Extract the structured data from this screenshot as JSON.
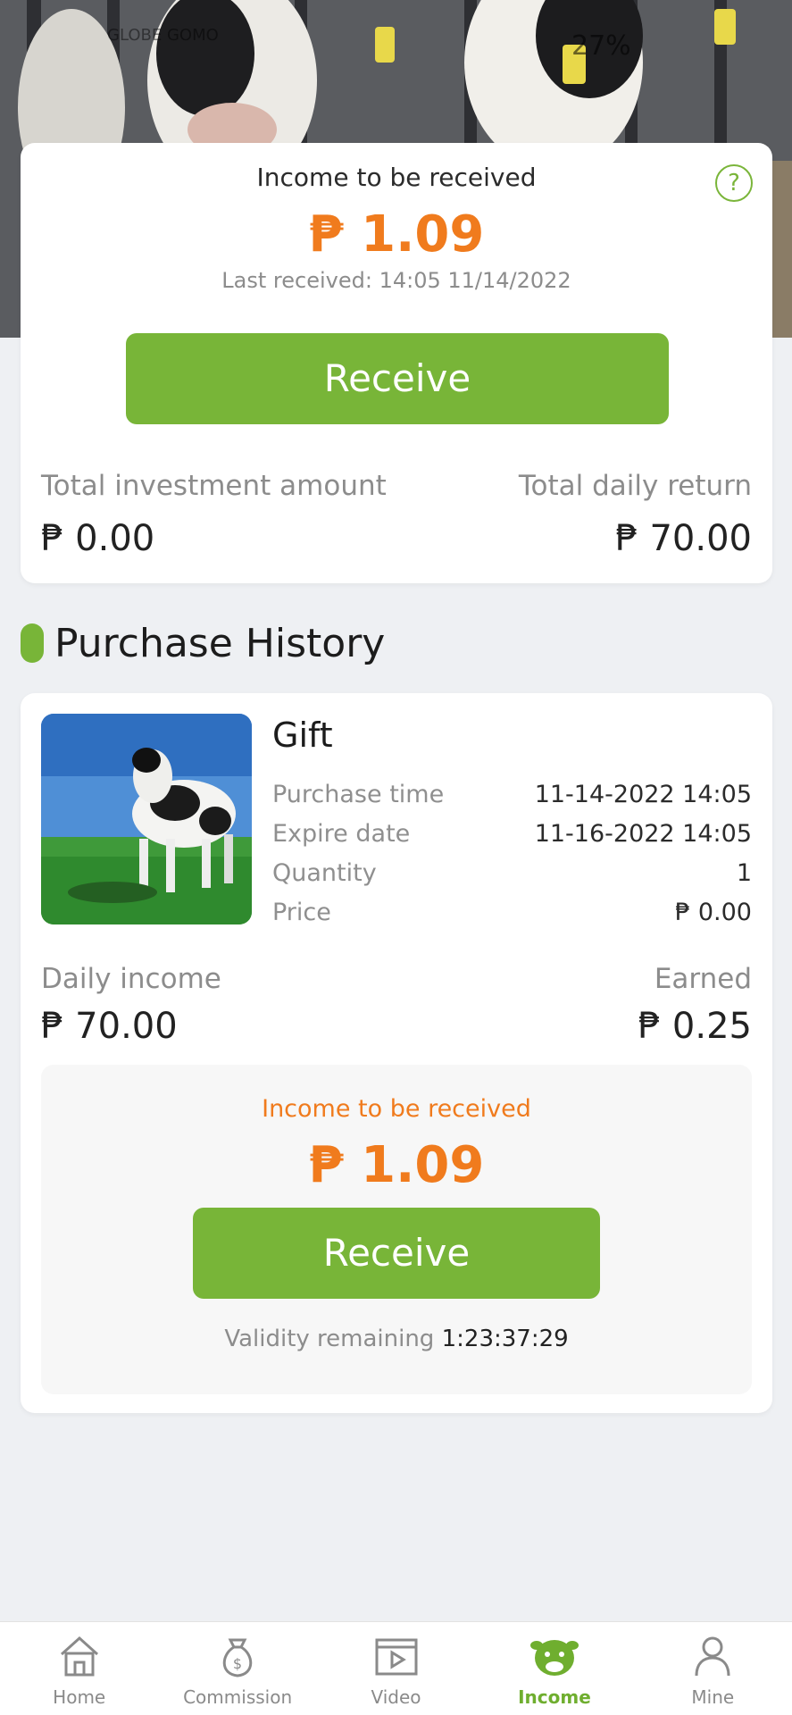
{
  "status_bar": {
    "carrier": "GLOBE GOMO",
    "battery": "27%"
  },
  "summary": {
    "title": "Income to be received",
    "amount": "₱ 1.09",
    "last_received": "Last received: 14:05 11/14/2022",
    "receive_label": "Receive",
    "total_investment_label": "Total investment amount",
    "total_investment_value": "₱ 0.00",
    "total_daily_label": "Total daily return",
    "total_daily_value": "₱ 70.00"
  },
  "section": {
    "title": "Purchase History"
  },
  "purchase": {
    "name": "Gift",
    "rows": [
      {
        "label": "Purchase time",
        "value": "11-14-2022 14:05"
      },
      {
        "label": "Expire date",
        "value": "11-16-2022 14:05"
      },
      {
        "label": "Quantity",
        "value": "1"
      },
      {
        "label": "Price",
        "value": "₱ 0.00"
      }
    ],
    "daily_income_label": "Daily income",
    "daily_income_value": "₱ 70.00",
    "earned_label": "Earned",
    "earned_value": "₱ 0.25",
    "pending_title": "Income to be received",
    "pending_amount": "₱ 1.09",
    "receive_label": "Receive",
    "validity_label": "Validity remaining",
    "validity_value": "1:23:37:29"
  },
  "tabs": [
    {
      "label": "Home",
      "icon": "home-icon",
      "active": false
    },
    {
      "label": "Commission",
      "icon": "money-bag-icon",
      "active": false
    },
    {
      "label": "Video",
      "icon": "video-icon",
      "active": false
    },
    {
      "label": "Income",
      "icon": "cow-icon",
      "active": true
    },
    {
      "label": "Mine",
      "icon": "user-icon",
      "active": false
    }
  ],
  "colors": {
    "accent_green": "#78b538",
    "amount_orange": "#f07b1d",
    "background": "#eef0f3"
  }
}
